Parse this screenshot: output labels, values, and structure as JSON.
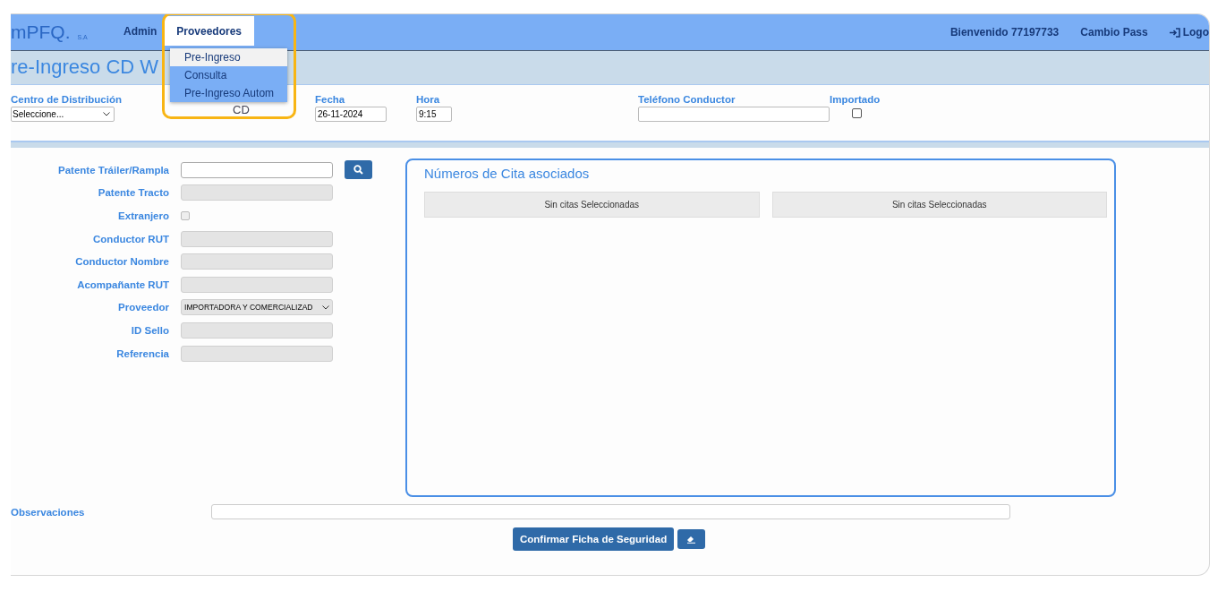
{
  "navbar": {
    "logo": "mPFQ.",
    "logo_suffix": "S.A",
    "menu": [
      {
        "label": "Admin",
        "selected": false
      },
      {
        "label": "Proveedores",
        "selected": true
      }
    ],
    "welcome": "Bienvenido 77197733",
    "change_password": "Cambio Pass",
    "logout": "Logo"
  },
  "dropdown": {
    "items": [
      {
        "label": "Pre-Ingreso",
        "selected": true
      },
      {
        "label": "Consulta",
        "selected": false
      },
      {
        "label": "Pre-Ingreso Autom",
        "selected": false
      }
    ]
  },
  "page_title": "re-Ingreso CD W",
  "header_fields": [
    {
      "kind": "select",
      "label": "Centro de Distribución",
      "value": "Seleccione..."
    },
    {
      "kind": "label",
      "label": "CD"
    },
    {
      "kind": "text",
      "label": "Fecha",
      "value": "26-11-2024"
    },
    {
      "kind": "text",
      "label": "Hora",
      "value": "9:15"
    },
    {
      "kind": "text",
      "label": "Teléfono Conductor"
    },
    {
      "kind": "checkbox",
      "label": "Importado",
      "checked": false
    }
  ],
  "form_fields": [
    {
      "kind": "text",
      "label": "Patente Tráiler/Rampla",
      "disabled": false
    },
    {
      "kind": "text",
      "label": "Patente Tracto",
      "disabled": true
    },
    {
      "kind": "checkbox",
      "label": "Extranjero",
      "disabled": true,
      "checked": false
    },
    {
      "kind": "text",
      "label": "Conductor RUT",
      "disabled": true
    },
    {
      "kind": "text",
      "label": "Conductor Nombre",
      "disabled": true
    },
    {
      "kind": "text",
      "label": "Acompañante RUT",
      "disabled": true
    },
    {
      "kind": "select",
      "label": "Proveedor",
      "value": "IMPORTADORA Y COMERCIALIZAD",
      "disabled": true
    },
    {
      "kind": "text",
      "label": "ID Sello",
      "disabled": true
    },
    {
      "kind": "text",
      "label": "Referencia",
      "disabled": true
    }
  ],
  "citas_panel": {
    "title": "Números de Cita asociados",
    "columns": [
      "Sin citas Seleccionadas",
      "Sin citas Seleccionadas"
    ]
  },
  "observaciones": {
    "label": "Observaciones"
  },
  "confirm_button": "Confirmar Ficha de Seguridad"
}
